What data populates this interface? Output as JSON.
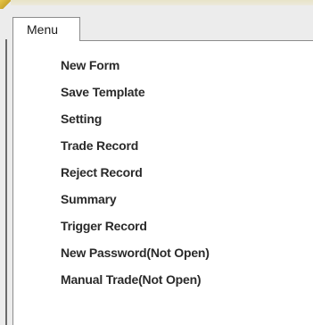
{
  "menu": {
    "title": "Menu",
    "items": [
      {
        "label": "New Form"
      },
      {
        "label": "Save Template"
      },
      {
        "label": "Setting"
      },
      {
        "label": "Trade Record"
      },
      {
        "label": "Reject Record"
      },
      {
        "label": "Summary"
      },
      {
        "label": "Trigger Record"
      },
      {
        "label": "New Password(Not Open)"
      },
      {
        "label": "Manual Trade(Not Open)"
      }
    ]
  },
  "colors": {
    "menu_background": "#ffffff",
    "menu_border": "#8c8c8c",
    "text": "#2a2a2a",
    "window_background": "#ececec"
  }
}
